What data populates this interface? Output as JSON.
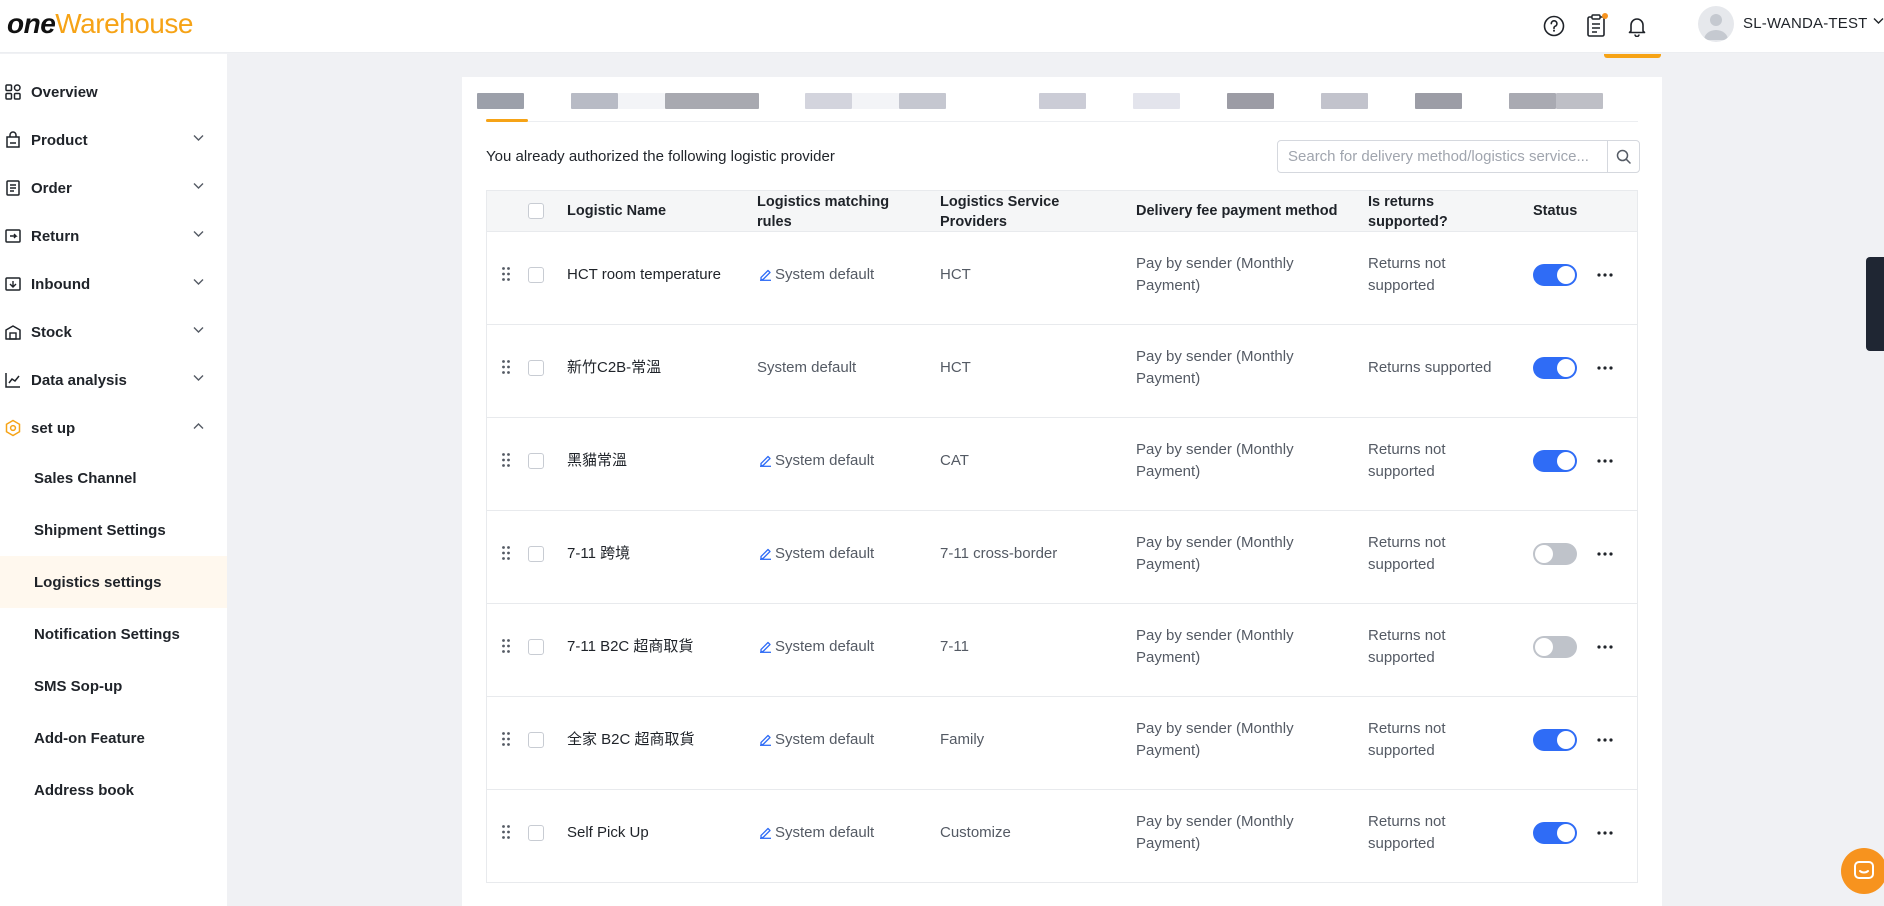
{
  "header": {
    "logo_one": "one",
    "logo_warehouse": "Warehouse",
    "user_name": "SL-WANDA-TEST",
    "icons": [
      "help-icon",
      "clipboard-icon",
      "bell-icon",
      "avatar",
      "chevron-down-icon"
    ]
  },
  "sidebar": {
    "items": [
      {
        "label": "Overview",
        "icon": "overview-icon"
      },
      {
        "label": "Product",
        "icon": "product-icon"
      },
      {
        "label": "Order",
        "icon": "order-icon"
      },
      {
        "label": "Return",
        "icon": "return-icon"
      },
      {
        "label": "Inbound",
        "icon": "inbound-icon"
      },
      {
        "label": "Stock",
        "icon": "stock-icon"
      },
      {
        "label": "Data analysis",
        "icon": "data-analysis-icon"
      },
      {
        "label": "set up",
        "icon": "setup-icon"
      }
    ],
    "sub_items": [
      {
        "label": "Sales Channel"
      },
      {
        "label": "Shipment Settings"
      },
      {
        "label": "Logistics settings",
        "active": true
      },
      {
        "label": "Notification Settings"
      },
      {
        "label": "SMS Sop-up"
      },
      {
        "label": "Add-on Feature"
      },
      {
        "label": "Address book"
      }
    ]
  },
  "main": {
    "auth_text": "You already authorized the following logistic provider",
    "search_placeholder": "Search for delivery method/logistics service...",
    "columns": {
      "name": "Logistic Name",
      "rules": "Logistics matching rules",
      "provider": "Logistics Service Providers",
      "payment": "Delivery fee payment method",
      "returns": "Is returns supported?",
      "status": "Status"
    },
    "rows": [
      {
        "name": "HCT room temperature",
        "rules": "System default",
        "editable": true,
        "provider": "HCT",
        "payment": "Pay by sender (Monthly Payment)",
        "returns": "Returns not supported",
        "enabled": true
      },
      {
        "name": "新竹C2B-常溫",
        "rules": "System default",
        "editable": false,
        "provider": "HCT",
        "payment": "Pay by sender (Monthly Payment)",
        "returns": "Returns supported",
        "enabled": true
      },
      {
        "name": "黑貓常溫",
        "rules": "System default",
        "editable": true,
        "provider": "CAT",
        "payment": "Pay by sender (Monthly Payment)",
        "returns": "Returns not supported",
        "enabled": true
      },
      {
        "name": "7-11 跨境",
        "rules": "System default",
        "editable": true,
        "provider": "7-11 cross-border",
        "payment": "Pay by sender (Monthly Payment)",
        "returns": "Returns not supported",
        "enabled": false
      },
      {
        "name": "7-11 B2C 超商取貨",
        "rules": "System default",
        "editable": true,
        "provider": "7-11",
        "payment": "Pay by sender (Monthly Payment)",
        "returns": "Returns not supported",
        "enabled": false
      },
      {
        "name": "全家 B2C 超商取貨",
        "rules": "System default",
        "editable": true,
        "provider": "Family",
        "payment": "Pay by sender (Monthly Payment)",
        "returns": "Returns not supported",
        "enabled": true
      },
      {
        "name": "Self Pick Up",
        "rules": "System default",
        "editable": true,
        "provider": "Customize",
        "payment": "Pay by sender (Monthly Payment)",
        "returns": "Returns not supported",
        "enabled": true
      }
    ]
  },
  "colors": {
    "accent": "#f6a316",
    "toggle_on": "#2f6cf6",
    "toggle_off": "#bfc3ca",
    "edit_icon": "#2f6cf6"
  }
}
